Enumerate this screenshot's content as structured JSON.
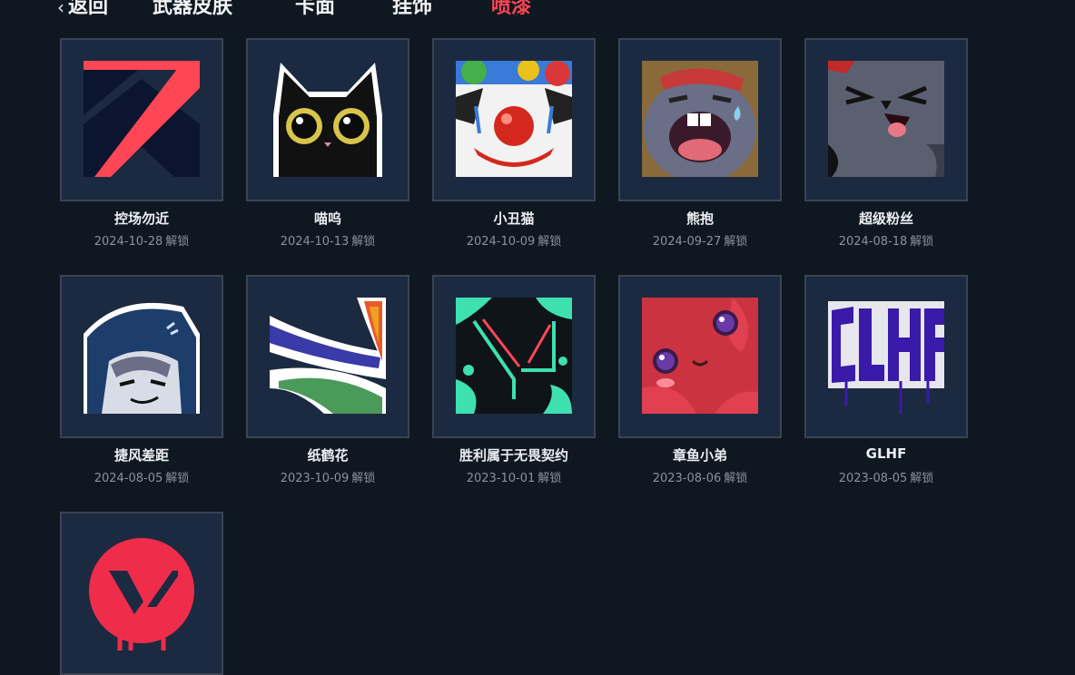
{
  "nav": {
    "back_label": "返回",
    "tabs": [
      {
        "label": "武器皮肤",
        "active": false
      },
      {
        "label": "卡面",
        "active": false
      },
      {
        "label": "挂饰",
        "active": false
      },
      {
        "label": "喷漆",
        "active": true
      }
    ]
  },
  "unlock_suffix": "解锁",
  "sprays": [
    {
      "name": "控场勿近",
      "date": "2024-10-28",
      "icon": "control-zone-spray-icon"
    },
    {
      "name": "喵呜",
      "date": "2024-10-13",
      "icon": "black-cat-spray-icon"
    },
    {
      "name": "小丑猫",
      "date": "2024-10-09",
      "icon": "clown-cat-spray-icon"
    },
    {
      "name": "熊抱",
      "date": "2024-09-27",
      "icon": "crying-creature-spray-icon"
    },
    {
      "name": "超级粉丝",
      "date": "2024-08-18",
      "icon": "super-fan-spray-icon"
    },
    {
      "name": "捷风差距",
      "date": "2024-08-05",
      "icon": "jett-hooded-spray-icon"
    },
    {
      "name": "纸鹤花",
      "date": "2023-10-09",
      "icon": "paper-crane-flower-spray-icon"
    },
    {
      "name": "胜利属于无畏契约",
      "date": "2023-10-01",
      "icon": "valorant-splash-spray-icon"
    },
    {
      "name": "章鱼小弟",
      "date": "2023-08-06",
      "icon": "octopus-spray-icon"
    },
    {
      "name": "GLHF",
      "date": "2023-08-05",
      "icon": "glhf-graffiti-spray-icon"
    },
    {
      "name": "",
      "date": "",
      "icon": "valorant-logo-spray-icon"
    }
  ],
  "colors": {
    "accent": "#ff4655",
    "background": "#0f1721",
    "card": "#1b2a40"
  }
}
